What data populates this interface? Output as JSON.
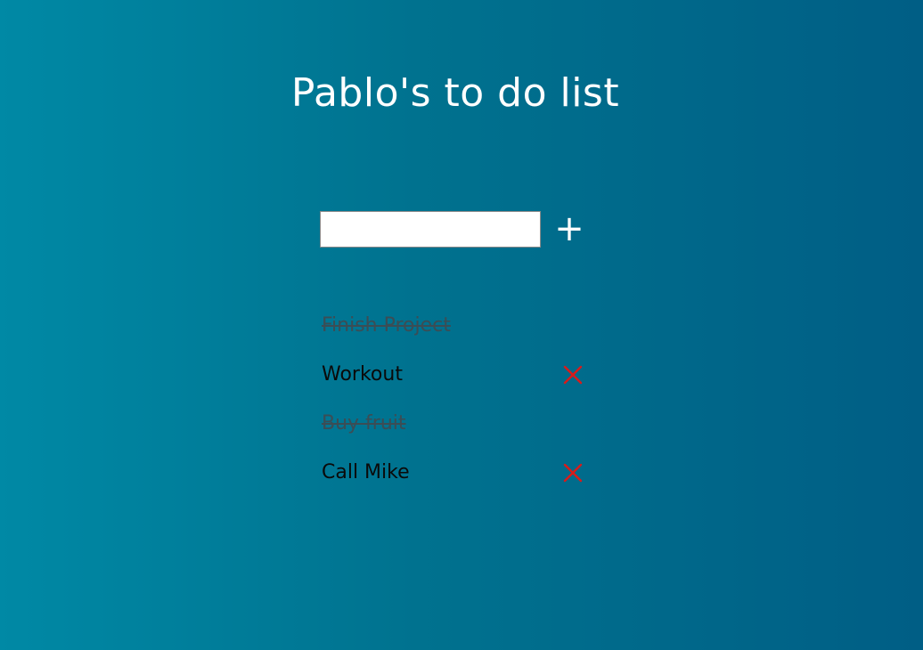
{
  "title": "Pablo's to do list",
  "new_task": {
    "value": "",
    "placeholder": "",
    "add_label": "+"
  },
  "tasks": [
    {
      "text": "Finish Project",
      "done": true
    },
    {
      "text": "Workout",
      "done": false
    },
    {
      "text": "Buy fruit",
      "done": true
    },
    {
      "text": "Call Mike",
      "done": false
    }
  ],
  "icons": {
    "delete": "close-icon",
    "add": "plus-icon"
  },
  "colors": {
    "background_left": "#0089a5",
    "background_right": "#005e85",
    "delete_icon": "#d81b1b",
    "done_text": "#3b4d55"
  }
}
